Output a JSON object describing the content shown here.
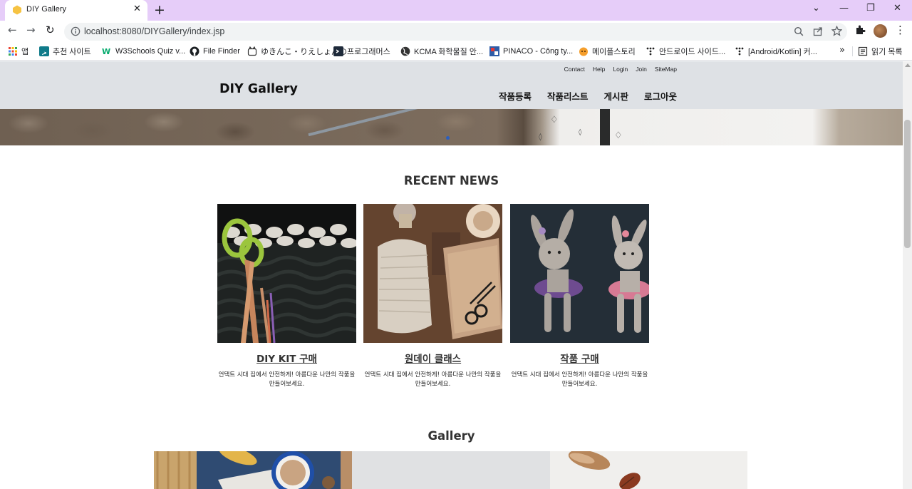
{
  "browser": {
    "tab_title": "DIY Gallery",
    "tab_close": "✕",
    "new_tab": "+",
    "url": "localhost:8080/DIYGallery/index.jsp",
    "window_controls": {
      "dropdown": "⌄",
      "minimize": "—",
      "restore": "❐",
      "close": "✕"
    },
    "nav": {
      "back": "←",
      "forward": "→",
      "reload": "↻"
    },
    "bookmarks": [
      {
        "label": "앱",
        "icon": "apps-grid-icon"
      },
      {
        "label": "추천 사이트",
        "icon": "bing-icon"
      },
      {
        "label": "W3Schools Quiz v...",
        "icon": "w3schools-icon"
      },
      {
        "label": "File Finder",
        "icon": "github-icon"
      },
      {
        "label": "ゆきんこ・りえしょんの...",
        "icon": "cat-icon"
      },
      {
        "label": "프로그래머스",
        "icon": "programmers-icon"
      },
      {
        "label": "KCMA 화학물질 안...",
        "icon": "globe-icon"
      },
      {
        "label": "PINACO - Công ty...",
        "icon": "pinaco-icon"
      },
      {
        "label": "메이플스토리",
        "icon": "maplestory-icon"
      },
      {
        "label": "안드로이드 사이드...",
        "icon": "dots-icon"
      },
      {
        "label": "[Android/Kotlin] 커...",
        "icon": "dots-icon"
      }
    ],
    "bookmarks_more": "»",
    "reading_list": "읽기 목록"
  },
  "site": {
    "logo": "DIY Gallery",
    "util_nav": [
      "Contact",
      "Help",
      "Login",
      "Join",
      "SiteMap"
    ],
    "main_nav": [
      "작품등록",
      "작품리스트",
      "게시판",
      "로그아웃"
    ],
    "recent_news_title": "RECENT NEWS",
    "cards": [
      {
        "title": "DIY KIT 구매",
        "desc": "언택트 시대 집에서 안전하게! 아름다운 나만의 작품을 만들어보세요."
      },
      {
        "title": "원데이 클래스",
        "desc": "언택트 시대 집에서 안전하게! 아름다운 나만의 작품을 만들어보세요."
      },
      {
        "title": "작품 구매",
        "desc": "언택트 시대 집에서 안전하게! 아름다운 나만의 작품을 만들어보세요."
      }
    ],
    "gallery_title": "Gallery"
  },
  "colors": {
    "tabstrip": "#e6cdf9",
    "header_bg": "#dee1e5",
    "carousel_dot": "#2b5fbf"
  }
}
